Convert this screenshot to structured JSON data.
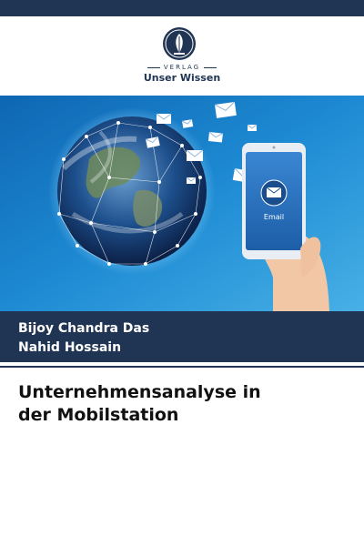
{
  "publisher": {
    "label_small": "VERLAG",
    "name": "Unser Wissen"
  },
  "cover": {
    "email_label": "Email"
  },
  "authors": [
    "Bijoy Chandra Das",
    "Nahid Hossain"
  ],
  "title_lines": [
    "Unternehmensanalyse in",
    "der Mobilstation"
  ],
  "colors": {
    "navy": "#1f3553",
    "sky": "#1a7fc8",
    "phone_screen": "#2c6fb6"
  }
}
